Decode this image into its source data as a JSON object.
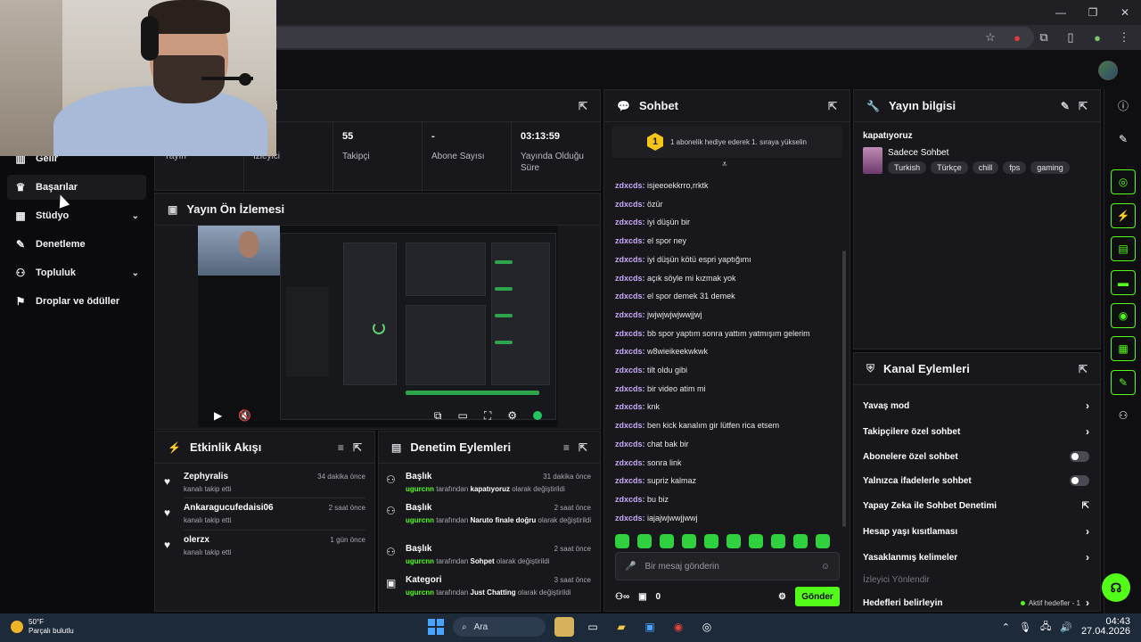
{
  "nav": {
    "items": [
      {
        "label": "Gelir",
        "icon": "dashboard-icon"
      },
      {
        "label": "Başarılar",
        "icon": "trophy-icon"
      },
      {
        "label": "Stüdyo",
        "icon": "studio-icon"
      },
      {
        "label": "Denetleme",
        "icon": "wrench-icon"
      },
      {
        "label": "Topluluk",
        "icon": "community-icon"
      },
      {
        "label": "Droplar ve ödüller",
        "icon": "drops-icon"
      }
    ]
  },
  "stats": {
    "items": [
      {
        "value": "",
        "label": "Yayın"
      },
      {
        "value": "",
        "label": "İzleyici"
      },
      {
        "value": "55",
        "label": "Takipçi"
      },
      {
        "value": "-",
        "label": "Abone Sayısı"
      },
      {
        "value": "03:13:59",
        "label": "Yayında Olduğu Süre"
      }
    ],
    "header_partial": "i"
  },
  "preview": {
    "title": "Yayın Ön İzlemesi"
  },
  "activity": {
    "title": "Etkinlik Akışı",
    "items": [
      {
        "user": "Zephyralis",
        "sub": "kanalı takip etti",
        "time": "34 dakika önce"
      },
      {
        "user": "Ankaragucufedaisi06",
        "sub": "kanalı takip etti",
        "time": "2 saat önce"
      },
      {
        "user": "olerzx",
        "sub": "kanalı takip etti",
        "time": "1 gün önce"
      }
    ]
  },
  "moderation": {
    "title": "Denetim Eylemleri",
    "items": [
      {
        "title": "Başlık",
        "time": "31 dakika önce",
        "actor": "ugurcnn",
        "mid": "tarafından",
        "value": "kapatıyoruz",
        "suffix": "olarak değiştirildi"
      },
      {
        "title": "Başlık",
        "time": "2 saat önce",
        "actor": "ugurcnn",
        "mid": "tarafından",
        "value": "Naruto finale doğru",
        "suffix": "olarak değiştirildi"
      },
      {
        "title": "Başlık",
        "time": "2 saat önce",
        "actor": "ugurcnn",
        "mid": "tarafından",
        "value": "Sohpet",
        "suffix": "olarak değiştirildi"
      },
      {
        "title": "Kategori",
        "time": "3 saat önce",
        "actor": "ugurcnn",
        "mid": "tarafından",
        "value": "Just Chatting",
        "suffix": "olarak değiştirildi"
      }
    ]
  },
  "chat": {
    "title": "Sohbet",
    "pin_number": "1",
    "pin_text": "1 abonelik hediye ederek 1. sıraya yükselin",
    "messages": [
      {
        "user": "zdxcds:",
        "text": "isjeeoekkrro,rrktk"
      },
      {
        "user": "zdxcds:",
        "text": "özür"
      },
      {
        "user": "zdxcds:",
        "text": "iyi düşün bir"
      },
      {
        "user": "zdxcds:",
        "text": "el spor ney"
      },
      {
        "user": "zdxcds:",
        "text": "iyi düşün kötü espri yaptığımı"
      },
      {
        "user": "zdxcds:",
        "text": "açık söyle mi kızmak yok"
      },
      {
        "user": "zdxcds:",
        "text": "el spor demek 31 demek"
      },
      {
        "user": "zdxcds:",
        "text": "jwjwjwjwjwwjjwj"
      },
      {
        "user": "zdxcds:",
        "text": "bb spor yaptım sonra yattım yatmışım gelerim"
      },
      {
        "user": "zdxcds:",
        "text": "w8wieikeekwkwk"
      },
      {
        "user": "zdxcds:",
        "text": "tilt oldu gibi"
      },
      {
        "user": "zdxcds:",
        "text": "bir video atim mi"
      },
      {
        "user": "zdxcds:",
        "text": "knk"
      },
      {
        "user": "zdxcds:",
        "text": "ben kick kanalım gir lütfen rica etsem"
      },
      {
        "user": "zdxcds:",
        "text": "chat bak bir"
      },
      {
        "user": "zdxcds:",
        "text": "sonra link"
      },
      {
        "user": "zdxcds:",
        "text": "supriz kalmaz"
      },
      {
        "user": "zdxcds:",
        "text": "bu biz"
      },
      {
        "user": "zdxcds:",
        "text": "iajajwjwwjjwwj"
      }
    ],
    "placeholder": "Bir mesaj gönderin",
    "viewer_count": "0",
    "send_label": "Gönder"
  },
  "stream_info": {
    "title": "Yayın bilgisi",
    "stream_title": "kapatıyoruz",
    "category": "Sadece Sohbet",
    "tags": [
      "Turkish",
      "Türkçe",
      "chill",
      "fps",
      "gaming"
    ]
  },
  "channel_actions": {
    "title": "Kanal Eylemleri",
    "rows": [
      {
        "label": "Yavaş mod",
        "kind": "chevron"
      },
      {
        "label": "Takipçilere özel sohbet",
        "kind": "chevron"
      },
      {
        "label": "Abonelere özel sohbet",
        "kind": "toggle"
      },
      {
        "label": "Yalnızca ifadelerle sohbet",
        "kind": "toggle"
      },
      {
        "label": "Yapay Zeka ile Sohbet Denetimi",
        "kind": "external"
      },
      {
        "label": "Hesap yaşı kısıtlaması",
        "kind": "chevron"
      },
      {
        "label": "Yasaklanmış kelimeler",
        "kind": "chevron"
      },
      {
        "label": "İzleyici Yönlendir",
        "kind": "muted"
      },
      {
        "label": "Hedefleri belirleyin",
        "kind": "goals"
      }
    ],
    "goals_status": "Aktif hedefler - 1"
  },
  "taskbar": {
    "temp": "50°F",
    "weather": "Parçalı bulutlu",
    "search": "Ara",
    "time": "04:43",
    "date": "27.04.2026"
  },
  "colors": {
    "accent": "#53fc18",
    "username": "#c9a9f5",
    "panel": "#18181c"
  }
}
